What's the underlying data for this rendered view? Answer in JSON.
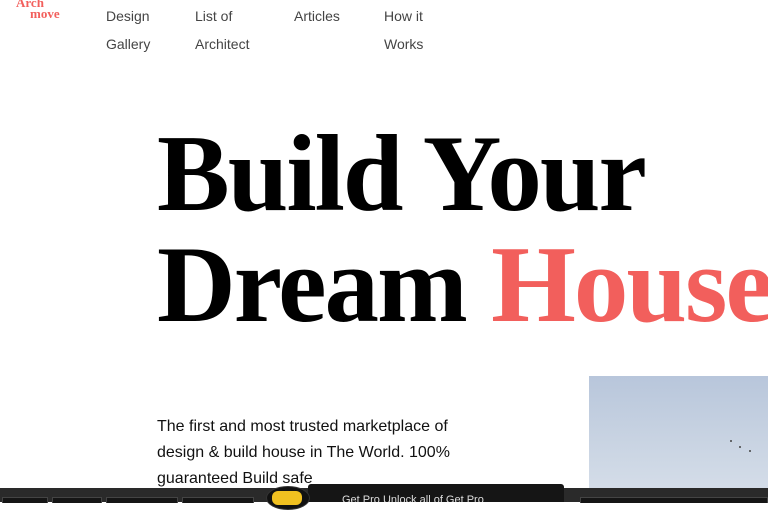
{
  "logo": {
    "line1": "Arch",
    "line2": "move"
  },
  "nav": {
    "items": [
      {
        "label_line1": "Design",
        "label_line2": "Gallery"
      },
      {
        "label_line1": "List of",
        "label_line2": "Architect"
      },
      {
        "label_line1": "Articles",
        "label_line2": ""
      },
      {
        "label_line1": "How it",
        "label_line2": "Works"
      }
    ]
  },
  "hero": {
    "line1": "Build Your",
    "line2_prefix": "Dream ",
    "line2_accent": "House",
    "description": "The first and most trusted marketplace of design & build house in The World. 100% guaranteed Build safe"
  },
  "toast": {
    "text": "Get Pro Unlock all of Get Pro"
  },
  "colors": {
    "accent": "#f25f5c",
    "text": "#000000",
    "bar": "#2a2a2a"
  }
}
